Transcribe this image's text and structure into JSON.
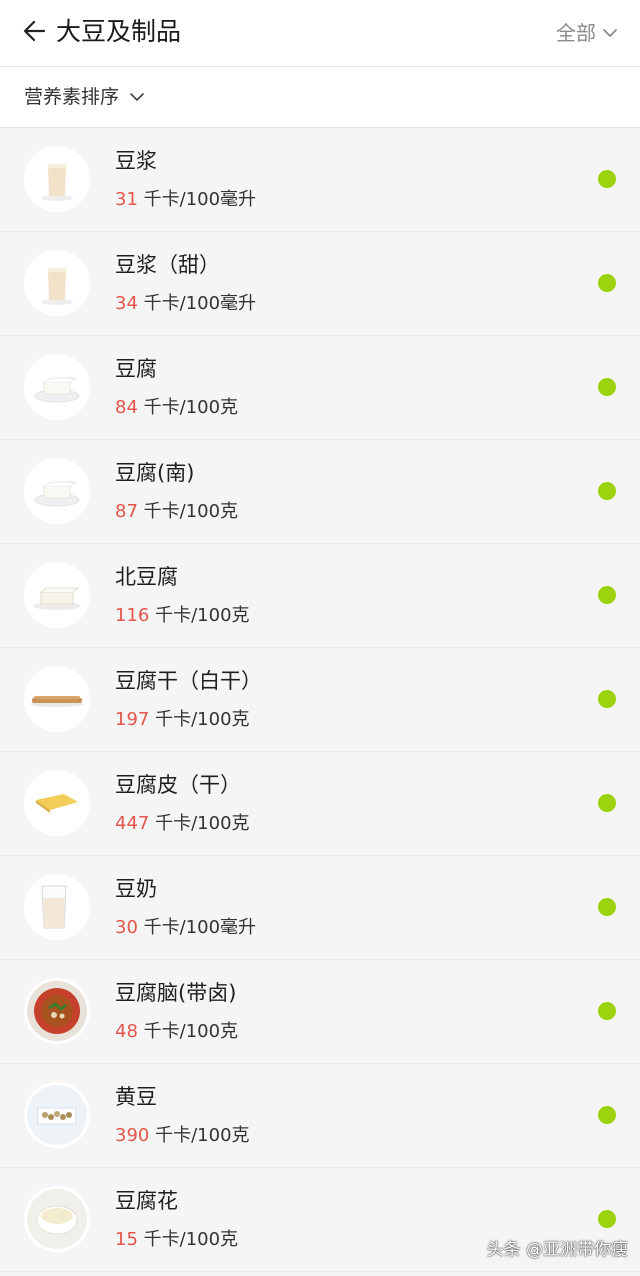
{
  "header": {
    "title": "大豆及制品",
    "filter_label": "全部"
  },
  "sort": {
    "label": "营养素排序"
  },
  "unit": "千卡",
  "items": [
    {
      "name": "豆浆",
      "calories": "31",
      "per": "/100毫升",
      "image": "soy-milk-cup",
      "dot_color": "#9bd40f"
    },
    {
      "name": "豆浆（甜）",
      "calories": "34",
      "per": "/100毫升",
      "image": "soy-milk-cup",
      "dot_color": "#9bd40f"
    },
    {
      "name": "豆腐",
      "calories": "84",
      "per": "/100克",
      "image": "tofu-plate",
      "dot_color": "#9bd40f"
    },
    {
      "name": "豆腐(南)",
      "calories": "87",
      "per": "/100克",
      "image": "tofu-plate",
      "dot_color": "#9bd40f"
    },
    {
      "name": "北豆腐",
      "calories": "116",
      "per": "/100克",
      "image": "tofu-block",
      "dot_color": "#9bd40f"
    },
    {
      "name": "豆腐干（白干）",
      "calories": "197",
      "per": "/100克",
      "image": "dried-tofu-strips",
      "dot_color": "#9bd40f"
    },
    {
      "name": "豆腐皮（干）",
      "calories": "447",
      "per": "/100克",
      "image": "tofu-skin-sheet",
      "dot_color": "#9bd40f"
    },
    {
      "name": "豆奶",
      "calories": "30",
      "per": "/100毫升",
      "image": "soy-milk-glass",
      "dot_color": "#9bd40f"
    },
    {
      "name": "豆腐脑(带卤)",
      "calories": "48",
      "per": "/100克",
      "image": "tofu-pudding-bowl",
      "dot_color": "#9bd40f"
    },
    {
      "name": "黄豆",
      "calories": "390",
      "per": "/100克",
      "image": "soybeans-dish",
      "dot_color": "#9bd40f"
    },
    {
      "name": "豆腐花",
      "calories": "15",
      "per": "/100克",
      "image": "tofu-flower-bowl",
      "dot_color": "#9bd40f"
    }
  ],
  "watermark": "头条 @亚洲带你瘦"
}
